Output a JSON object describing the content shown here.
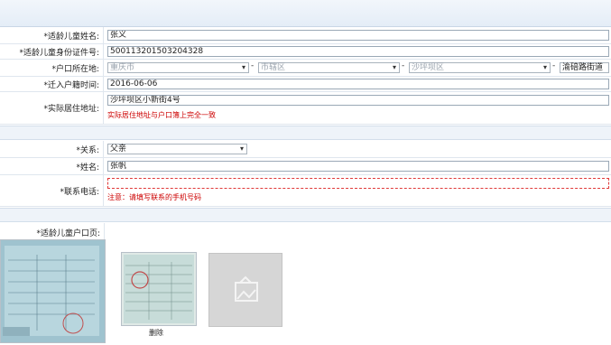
{
  "child": {
    "name_label": "*适龄儿童姓名:",
    "name_value": "张义",
    "id_label": "*适龄儿童身份证件号:",
    "id_value": "500113201503204328",
    "hukou_label": "*户口所在地:",
    "hukou_city": "重庆市",
    "hukou_district": "市辖区",
    "hukou_area": "沙坪坝区",
    "hukou_street": "渝碚路街道",
    "movein_label": "*迁入户籍时间:",
    "movein_value": "2016-06-06",
    "address_label": "*实际居住地址:",
    "address_value": "沙坪坝区小新街4号",
    "address_hint": "实际居住地址与户口簿上完全一致"
  },
  "guardian": {
    "relation_label": "*关系:",
    "relation_value": "父亲",
    "name_label": "*姓名:",
    "name_value": "张帆",
    "phone_label": "*联系电话:",
    "phone_value": "",
    "phone_hint": "注意：请填写联系的手机号码"
  },
  "upload": {
    "label": "*适龄儿童户口页:",
    "delete_label": "删除"
  },
  "colors": {
    "required": "#cc0000",
    "hint": "#cc0000",
    "header": "#e4edf7"
  }
}
